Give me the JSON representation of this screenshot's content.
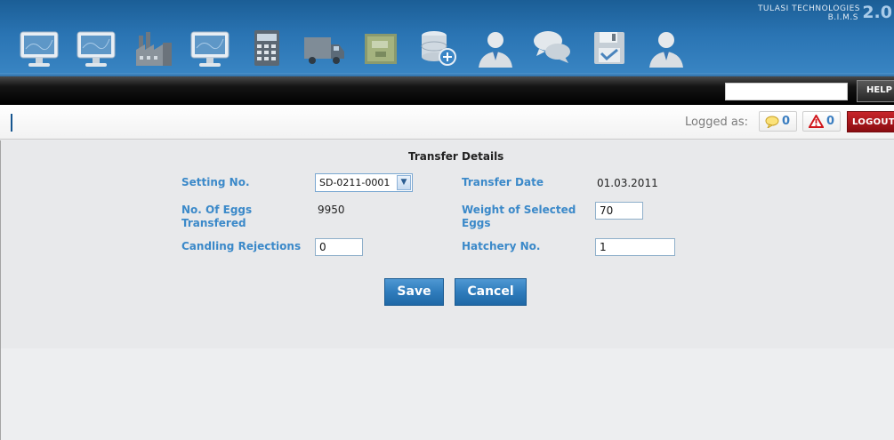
{
  "brand": {
    "company": "TULASI TECHNOLOGIES",
    "product": "B.I.M.S",
    "version": "2.0"
  },
  "nav_icons": [
    "monitor-icon",
    "monitor-icon",
    "factory-icon",
    "monitor-icon",
    "calculator-icon",
    "truck-icon",
    "map-icon",
    "database-add-icon",
    "user-icon",
    "chat-icon",
    "floppy-disk-icon",
    "user-icon"
  ],
  "toolbar": {
    "search_value": "",
    "help_label": "HELP"
  },
  "user_bar": {
    "logged_as_label": "Logged as:",
    "messages_count": "0",
    "alerts_count": "0",
    "logout_label": "LOGOUT"
  },
  "form": {
    "title": "Transfer Details",
    "setting_no_label": "Setting No.",
    "setting_no_value": "SD-0211-0001",
    "transfer_date_label": "Transfer Date",
    "transfer_date_value": "01.03.2011",
    "eggs_transfered_label_1": "No. Of Eggs",
    "eggs_transfered_label_2": "Transfered",
    "eggs_transfered_value": "9950",
    "weight_label_1": "Weight of Selected",
    "weight_label_2": "Eggs",
    "weight_value": "70",
    "candling_label": "Candling Rejections",
    "candling_value": "0",
    "hatchery_label": "Hatchery No.",
    "hatchery_value": "1",
    "save_label": "Save",
    "cancel_label": "Cancel"
  },
  "colors": {
    "header_blue": "#2a74b3",
    "label_blue": "#3b89c9",
    "button_blue": "#2f7cbc",
    "logout_red": "#b1171c"
  }
}
